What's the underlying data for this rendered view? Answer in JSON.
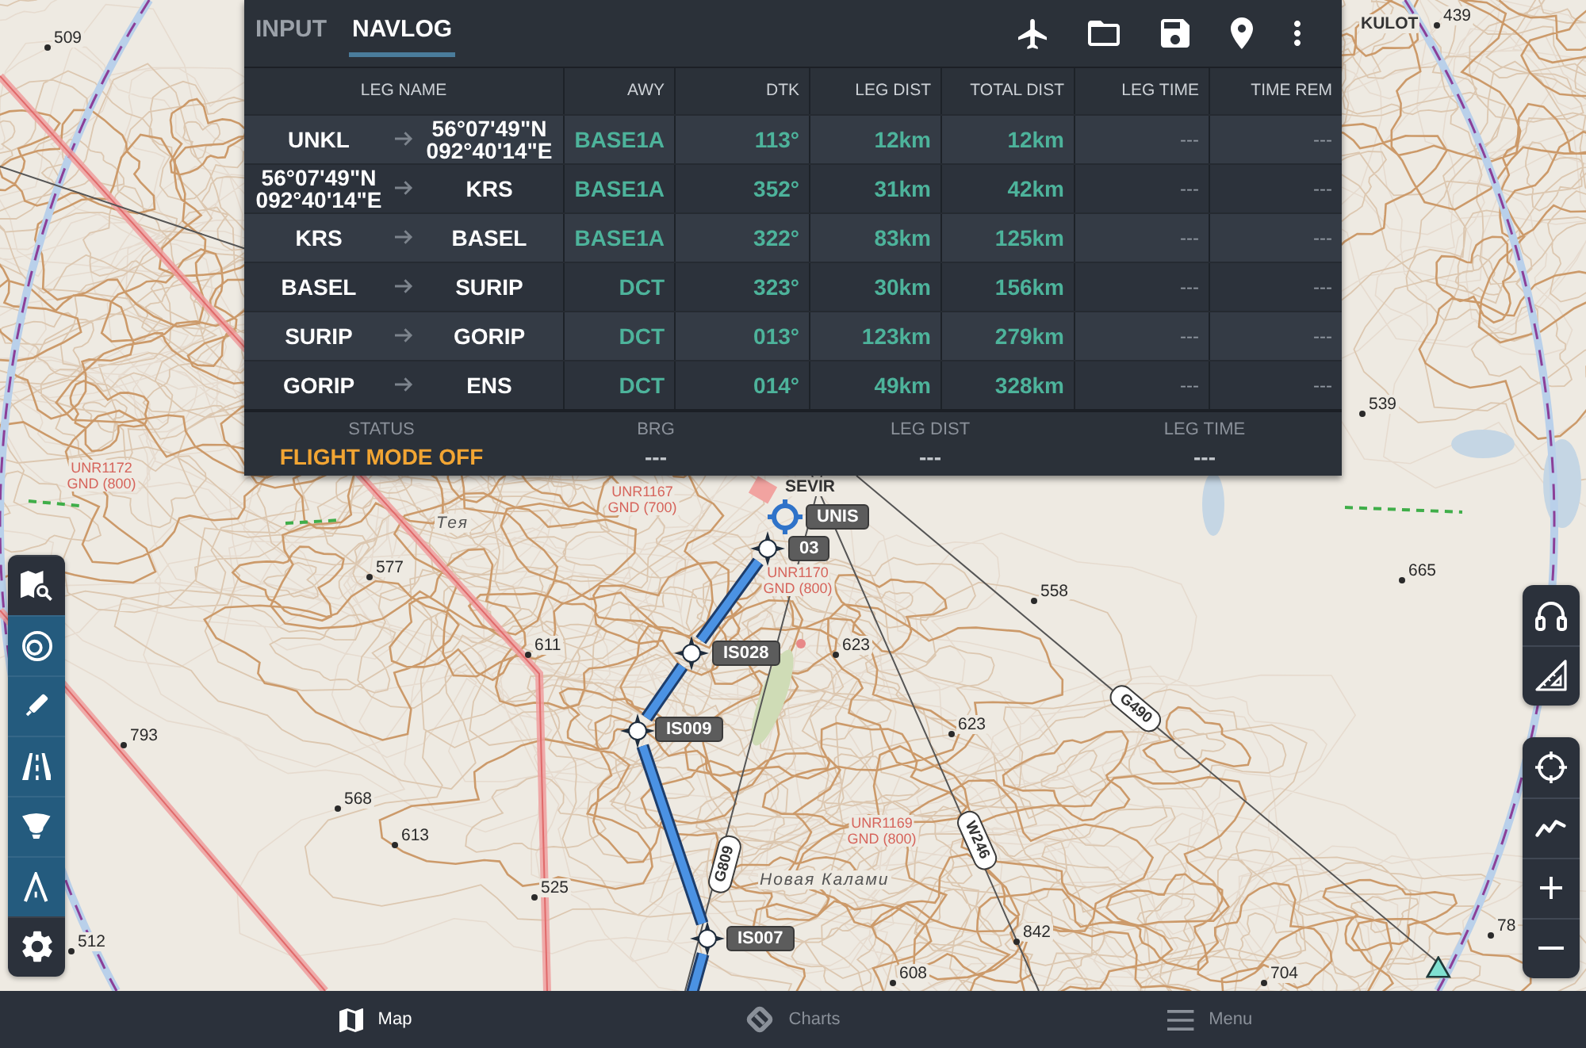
{
  "navlog": {
    "tabs": [
      {
        "label": "INPUT",
        "selected": false
      },
      {
        "label": "NAVLOG",
        "selected": true
      }
    ],
    "actions": [
      {
        "kind": "aircraft"
      },
      {
        "kind": "open"
      },
      {
        "kind": "save"
      },
      {
        "kind": "waypoint"
      },
      {
        "kind": "more"
      }
    ],
    "columns": [
      "LEG NAME",
      "AWY",
      "DTK",
      "LEG DIST",
      "TOTAL DIST",
      "LEG TIME",
      "TIME REM"
    ],
    "rows": [
      {
        "from": "UNKL",
        "to": "56°07'49\"N 092°40'14\"E",
        "airway": "BASE1A",
        "dtk": "113°",
        "leg_dist": "12km",
        "total_dist": "12km",
        "leg_time": "---",
        "time_rem": "---"
      },
      {
        "from": "56°07'49\"N 092°40'14\"E",
        "to": "KRS",
        "airway": "BASE1A",
        "dtk": "352°",
        "leg_dist": "31km",
        "total_dist": "42km",
        "leg_time": "---",
        "time_rem": "---"
      },
      {
        "from": "KRS",
        "to": "BASEL",
        "airway": "BASE1A",
        "dtk": "322°",
        "leg_dist": "83km",
        "total_dist": "125km",
        "leg_time": "---",
        "time_rem": "---"
      },
      {
        "from": "BASEL",
        "to": "SURIP",
        "airway": "DCT",
        "dtk": "323°",
        "leg_dist": "30km",
        "total_dist": "156km",
        "leg_time": "---",
        "time_rem": "---"
      },
      {
        "from": "SURIP",
        "to": "GORIP",
        "airway": "DCT",
        "dtk": "013°",
        "leg_dist": "123km",
        "total_dist": "279km",
        "leg_time": "---",
        "time_rem": "---"
      },
      {
        "from": "GORIP",
        "to": "ENS",
        "airway": "DCT",
        "dtk": "014°",
        "leg_dist": "49km",
        "total_dist": "328km",
        "leg_time": "---",
        "time_rem": "---"
      }
    ],
    "summary": [
      {
        "label": "STATUS",
        "value": "FLIGHT MODE OFF",
        "color": "#f2a533"
      },
      {
        "label": "BRG",
        "value": "---",
        "color": "#c3c7cc"
      },
      {
        "label": "LEG DIST",
        "value": "---",
        "color": "#c3c7cc"
      },
      {
        "label": "LEG TIME",
        "value": "---",
        "color": "#c3c7cc"
      }
    ]
  },
  "map": {
    "spot_heights": [
      "509",
      "439",
      "539",
      "577",
      "611",
      "558",
      "665",
      "623",
      "623",
      "793",
      "568",
      "613",
      "525",
      "512",
      "842",
      "608",
      "704",
      "78"
    ],
    "places": [
      {
        "name": "KULOT",
        "kind": "fix"
      },
      {
        "name": "Тея",
        "kind": "town"
      },
      {
        "name": "SEVIR",
        "kind": "fix"
      },
      {
        "name": "Новая Калами",
        "kind": "town"
      }
    ],
    "airspaces": [
      {
        "name": "UNR1172",
        "limits": "GND (800)"
      },
      {
        "name": "UNR1167",
        "limits": "GND (700)"
      },
      {
        "name": "UNR1170",
        "limits": "GND (800)"
      },
      {
        "name": "UNR1169",
        "limits": "GND (800)"
      }
    ],
    "airways": [
      "G809",
      "W246",
      "G490"
    ],
    "route": [
      {
        "label": "UNIS",
        "kind": "aerodrome"
      },
      {
        "label": "03",
        "kind": "waypoint"
      },
      {
        "label": "IS028",
        "kind": "waypoint"
      },
      {
        "label": "IS009",
        "kind": "waypoint"
      },
      {
        "label": "IS007",
        "kind": "waypoint"
      }
    ]
  },
  "layer_toolbar": [
    {
      "kind": "search",
      "on": false
    },
    {
      "kind": "airspace",
      "on": true
    },
    {
      "kind": "pen",
      "on": true
    },
    {
      "kind": "road",
      "on": true
    },
    {
      "kind": "lamp",
      "on": true
    },
    {
      "kind": "chevron",
      "on": true
    },
    {
      "kind": "settings",
      "on": false
    }
  ],
  "map_controls": [
    {
      "buttons": [
        {
          "kind": "audio"
        },
        {
          "kind": "ruler"
        }
      ]
    },
    {
      "buttons": [
        {
          "kind": "locate"
        },
        {
          "kind": "profile"
        },
        {
          "kind": "zoom_in"
        },
        {
          "kind": "zoom_out"
        }
      ]
    }
  ],
  "bottom_nav": [
    {
      "kind": "map",
      "label": "Map",
      "selected": true
    },
    {
      "kind": "charts",
      "label": "Charts",
      "selected": false
    },
    {
      "kind": "menu",
      "label": "Menu",
      "selected": false
    }
  ]
}
